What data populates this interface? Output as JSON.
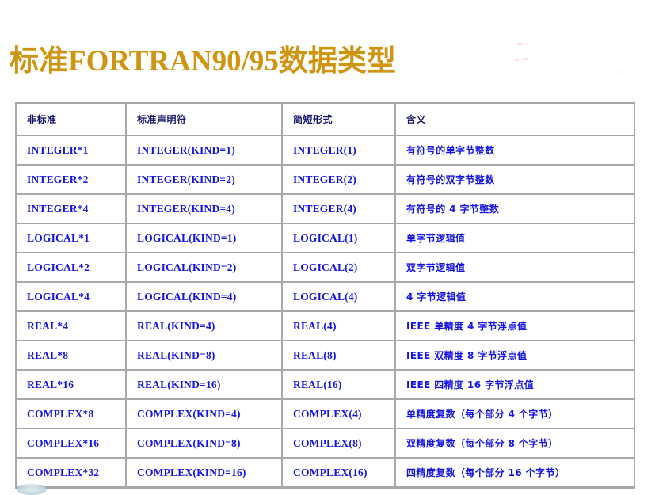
{
  "slide": {
    "title": "标准FORTRAN90/95数据类型",
    "title_color": "#cf9410",
    "background_color": "#ffffff"
  },
  "table": {
    "border_color": "#a8a8a8",
    "header_text_color": "#16166e",
    "body_text_color": "#1414e6",
    "columns": [
      {
        "key": "nonstandard",
        "label": "非标准"
      },
      {
        "key": "standard",
        "label": "标准声明符"
      },
      {
        "key": "short",
        "label": "简短形式"
      },
      {
        "key": "meaning",
        "label": "含义"
      }
    ],
    "rows": [
      {
        "nonstandard": "INTEGER*1",
        "standard": "INTEGER(KIND=1)",
        "short": "INTEGER(1)",
        "meaning": "有符号的单字节整数"
      },
      {
        "nonstandard": "INTEGER*2",
        "standard": "INTEGER(KIND=2)",
        "short": "INTEGER(2)",
        "meaning": "有符号的双字节整数"
      },
      {
        "nonstandard": "INTEGER*4",
        "standard": "INTEGER(KIND=4)",
        "short": "INTEGER(4)",
        "meaning": "有符号的 4 字节整数"
      },
      {
        "nonstandard": "LOGICAL*1",
        "standard": "LOGICAL(KIND=1)",
        "short": "LOGICAL(1)",
        "meaning": "单字节逻辑值"
      },
      {
        "nonstandard": "LOGICAL*2",
        "standard": "LOGICAL(KIND=2)",
        "short": "LOGICAL(2)",
        "meaning": "双字节逻辑值"
      },
      {
        "nonstandard": "LOGICAL*4",
        "standard": "LOGICAL(KIND=4)",
        "short": "LOGICAL(4)",
        "meaning": "4 字节逻辑值"
      },
      {
        "nonstandard": "REAL*4",
        "standard": "REAL(KIND=4)",
        "short": "REAL(4)",
        "meaning": "IEEE 单精度 4 字节浮点值"
      },
      {
        "nonstandard": "REAL*8",
        "standard": "REAL(KIND=8)",
        "short": "REAL(8)",
        "meaning": "IEEE 双精度 8 字节浮点值"
      },
      {
        "nonstandard": "REAL*16",
        "standard": "REAL(KIND=16)",
        "short": "REAL(16)",
        "meaning": "IEEE 四精度 16 字节浮点值"
      },
      {
        "nonstandard": "COMPLEX*8",
        "standard": "COMPLEX(KIND=4)",
        "short": "COMPLEX(4)",
        "meaning": "单精度复数（每个部分 4 个字节）"
      },
      {
        "nonstandard": "COMPLEX*16",
        "standard": "COMPLEX(KIND=8)",
        "short": "COMPLEX(8)",
        "meaning": "双精度复数（每个部分 8 个字节）"
      },
      {
        "nonstandard": "COMPLEX*32",
        "standard": "COMPLEX(KIND=16)",
        "short": "COMPLEX(16)",
        "meaning": "四精度复数（每个部分 16 个字节）"
      }
    ]
  }
}
